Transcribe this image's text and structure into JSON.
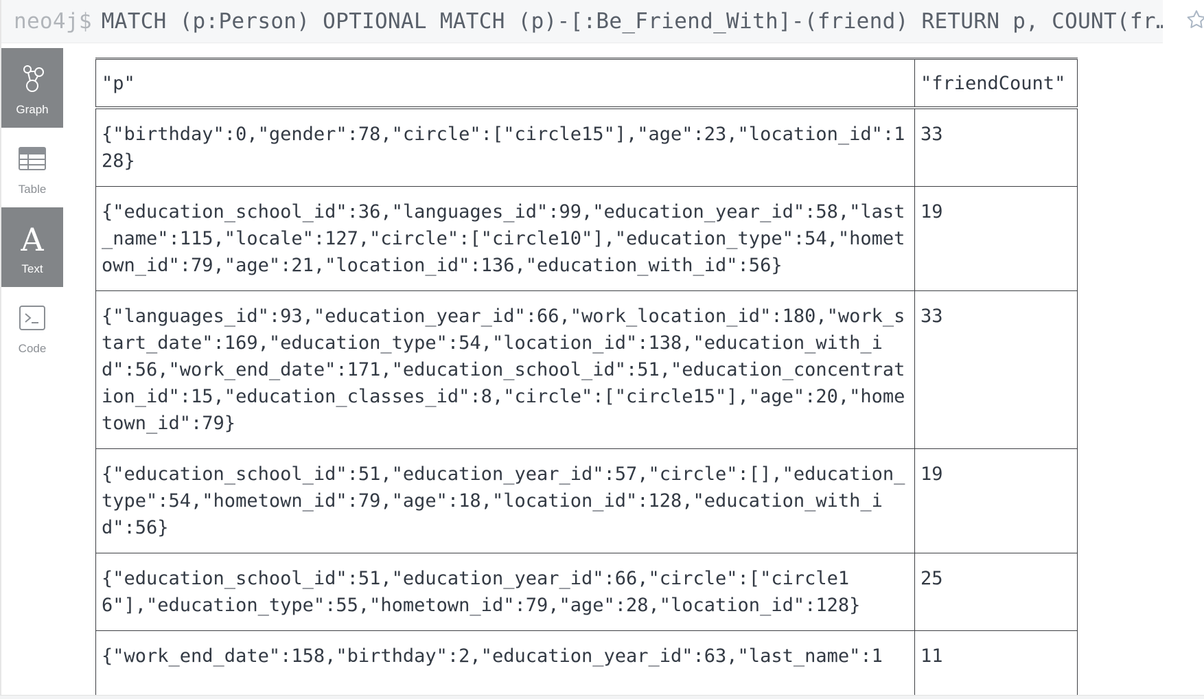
{
  "query": {
    "prompt": "neo4j$",
    "text": "MATCH (p:Person) OPTIONAL MATCH (p)-[:Be_Friend_With]-(friend) RETURN p, COUNT(fr…"
  },
  "view_tabs": [
    {
      "label": "Graph",
      "icon": "graph-icon",
      "active": true
    },
    {
      "label": "Table",
      "icon": "table-icon",
      "active": false
    },
    {
      "label": "Text",
      "icon": "text-icon",
      "active": true
    },
    {
      "label": "Code",
      "icon": "code-icon",
      "active": false
    }
  ],
  "table": {
    "columns": [
      "\"p\"",
      "\"friendCount\""
    ],
    "rows": [
      {
        "p": "{\"birthday\":0,\"gender\":78,\"circle\":[\"circle15\"],\"age\":23,\"location_id\":128}",
        "friendCount": "33"
      },
      {
        "p": "{\"education_school_id\":36,\"languages_id\":99,\"education_year_id\":58,\"last_name\":115,\"locale\":127,\"circle\":[\"circle10\"],\"education_type\":54,\"hometown_id\":79,\"age\":21,\"location_id\":136,\"education_with_id\":56}",
        "friendCount": "19"
      },
      {
        "p": "{\"languages_id\":93,\"education_year_id\":66,\"work_location_id\":180,\"work_start_date\":169,\"education_type\":54,\"location_id\":138,\"education_with_id\":56,\"work_end_date\":171,\"education_school_id\":51,\"education_concentration_id\":15,\"education_classes_id\":8,\"circle\":[\"circle15\"],\"age\":20,\"hometown_id\":79}",
        "friendCount": "33"
      },
      {
        "p": "{\"education_school_id\":51,\"education_year_id\":57,\"circle\":[],\"education_type\":54,\"hometown_id\":79,\"age\":18,\"location_id\":128,\"education_with_id\":56}",
        "friendCount": "19"
      },
      {
        "p": "{\"education_school_id\":51,\"education_year_id\":66,\"circle\":[\"circle16\"],\"education_type\":55,\"hometown_id\":79,\"age\":28,\"location_id\":128}",
        "friendCount": "25"
      },
      {
        "p": "{\"work_end_date\":158,\"birthday\":2,\"education_year_id\":63,\"last_name\":1",
        "friendCount": "11"
      }
    ]
  }
}
